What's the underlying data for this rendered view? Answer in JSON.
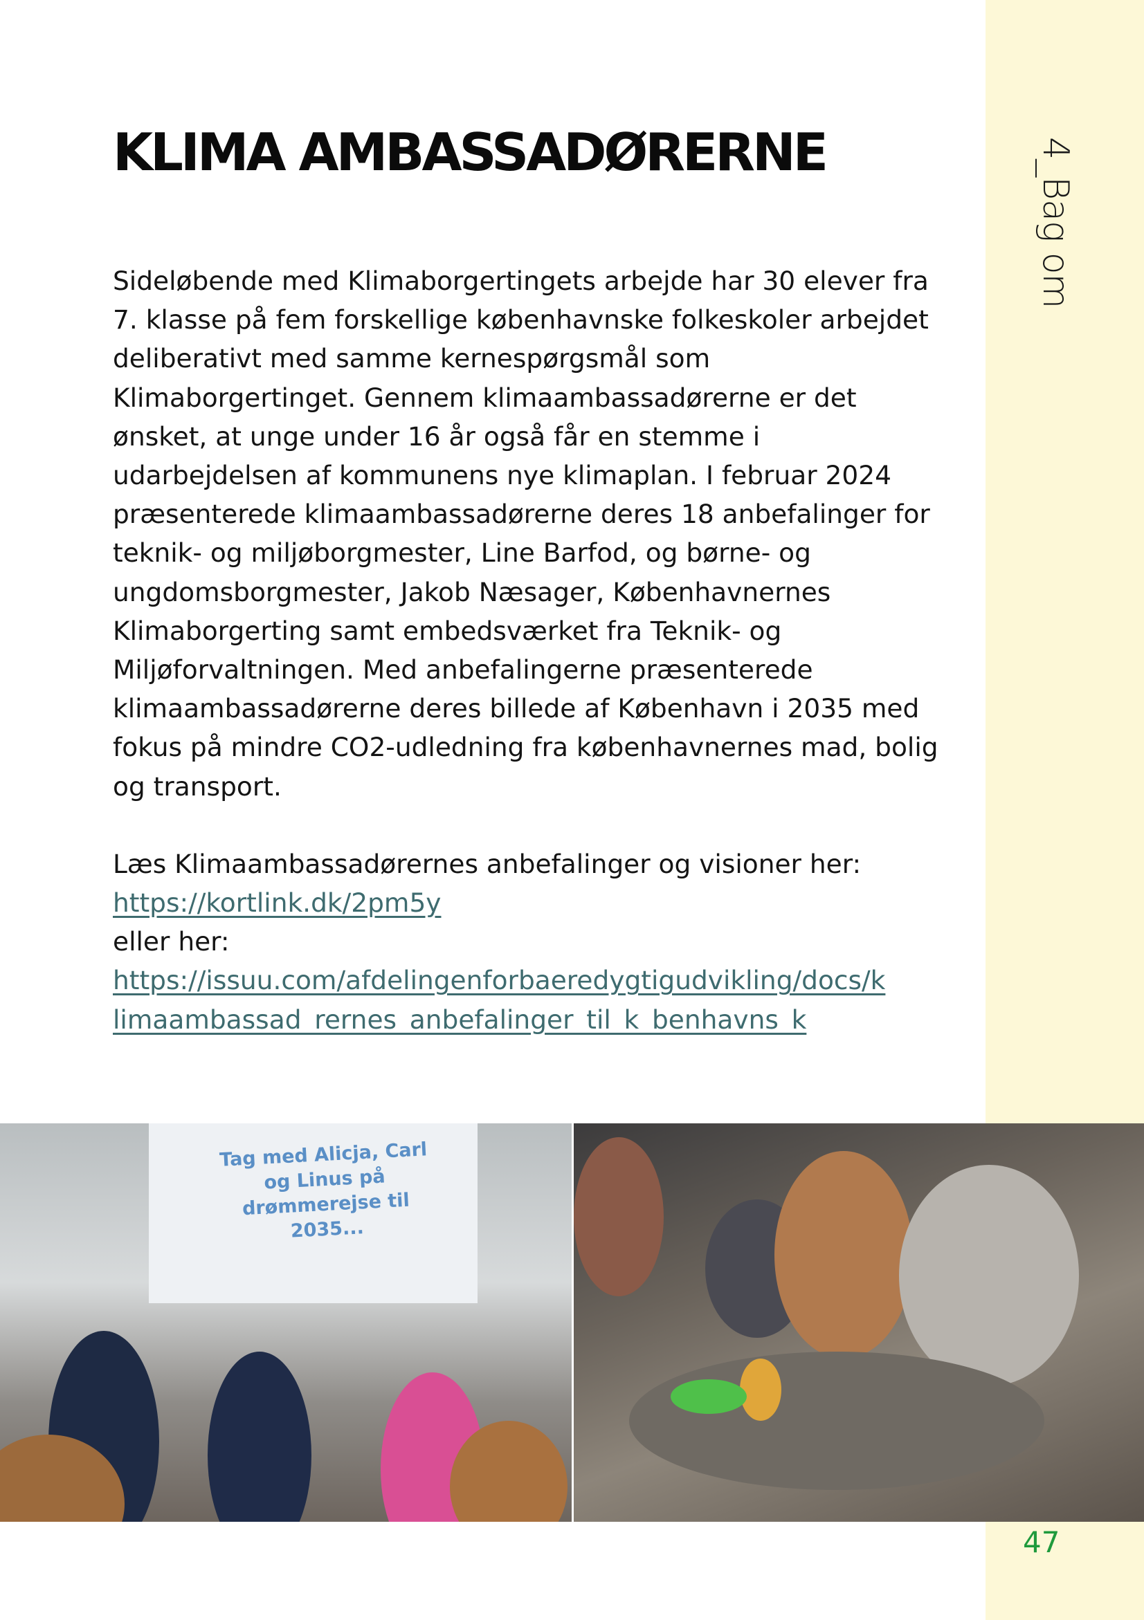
{
  "sidebar": {
    "label": "4_Bag om"
  },
  "title": "KLIMA AMBASSADØRERNE",
  "body": {
    "paragraph": "Sideløbende med Klimaborgertingets arbejde har 30 elever fra 7. klasse på fem forskellige københavnske folkeskoler arbejdet deliberativt med samme kernespørgsmål som Klimaborgertinget. Gennem klimaambassadørerne er det ønsket, at unge under 16 år også får en stemme i udarbejdelsen af kommunens nye klimaplan. I februar 2024 præsenterede klimaambassadørerne deres 18 anbefalinger for teknik- og miljøborgmester, Line Barfod, og børne- og ungdomsborgmester, Jakob Næsager, Københavnernes Klimaborgerting samt embedsværket fra Teknik- og Miljøforvaltningen. Med anbefalingerne præsenterede klimaambassadørerne deres billede af København i 2035 med fokus på mindre CO2-udledning fra københavnernes mad, bolig og transport.",
    "read_more": "Læs Klimaambassadørernes anbefalinger og visioner her:",
    "link1": "https://kortlink.dk/2pm5y",
    "or_here": "eller her:",
    "link2_line1": "https://issuu.com/afdelingenforbaeredygtigudvikling/docs/k",
    "link2_line2": "limaambassad_rernes_anbefalinger_til_k_benhavns_k"
  },
  "photos": {
    "left_screen_text": "Tag med Alicja, Carl og Linus på drømmerejse til 2035..."
  },
  "page_number": "47"
}
